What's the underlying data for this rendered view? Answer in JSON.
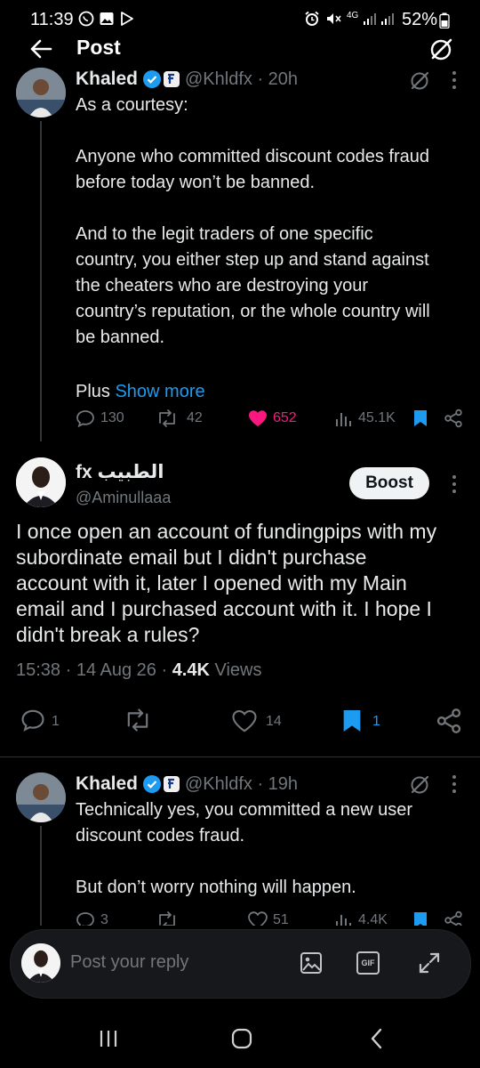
{
  "status_bar": {
    "time": "11:39",
    "network": "4G",
    "battery": "52%"
  },
  "header": {
    "title": "Post"
  },
  "tweet1": {
    "name": "Khaled",
    "handle": "@Khldfx · 20h",
    "lines": [
      "As a courtesy:",
      "",
      "Anyone who committed discount codes fraud",
      "before today won’t be banned.",
      "",
      "And to the legit traders of one specific",
      "country, you either step up and stand against",
      "the cheaters who are destroying your",
      "country’s reputation, or the whole country will",
      "be banned.",
      "",
      "Plus"
    ],
    "show_more": "Show more",
    "replies": "130",
    "reposts": "42",
    "likes": "652",
    "views": "45.1K"
  },
  "main": {
    "name": "fx الطبيب",
    "handle": "@Aminullaaa",
    "boost_label": "Boost",
    "lines": [
      "I once open an account of fundingpips with my",
      "subordinate email but I didn't purchase",
      "account with it, later I opened with my Main",
      "email and I purchased account with it. I hope I",
      "didn't break a rules?"
    ],
    "timestamp": "15:38 · 14 Aug 26 · ",
    "views_count": "4.4K",
    "views_label": " Views",
    "replies": "1",
    "likes": "14",
    "bookmarks": "1"
  },
  "tweet3": {
    "name": "Khaled",
    "handle": "@Khldfx · 19h",
    "lines": [
      "Technically yes, you committed  a new user",
      "discount codes fraud.",
      "",
      "But don’t worry nothing will happen."
    ],
    "replies": "3",
    "likes": "51",
    "views": "4.4K"
  },
  "reply_bar": {
    "placeholder": "Post your reply",
    "gif_label": "GIF"
  },
  "colors": {
    "accent": "#1d9bf0",
    "like": "#f91880",
    "muted": "#71767b",
    "background": "#000000"
  }
}
